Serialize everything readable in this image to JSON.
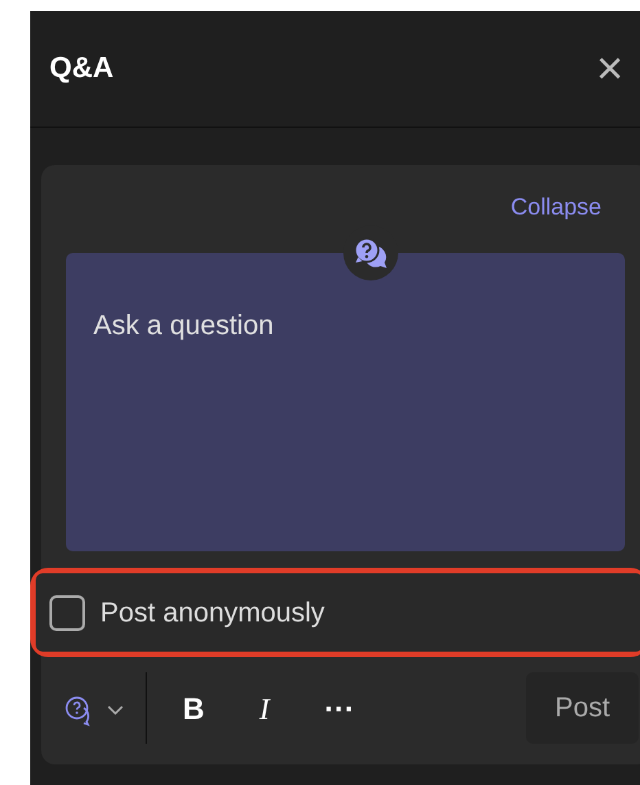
{
  "header": {
    "title": "Q&A",
    "close": "×"
  },
  "composer": {
    "collapse_link": "Collapse",
    "placeholder": "Ask a question",
    "anonymous": {
      "label": "Post anonymously",
      "checked": false,
      "highlighted": true
    },
    "toolbar": [
      {
        "kind": "type-picker"
      },
      {
        "kind": "bold",
        "label": "B"
      },
      {
        "kind": "italic",
        "label": "I"
      },
      {
        "kind": "more",
        "label": "···"
      }
    ],
    "post_button": {
      "label": "Post",
      "disabled": true
    }
  }
}
